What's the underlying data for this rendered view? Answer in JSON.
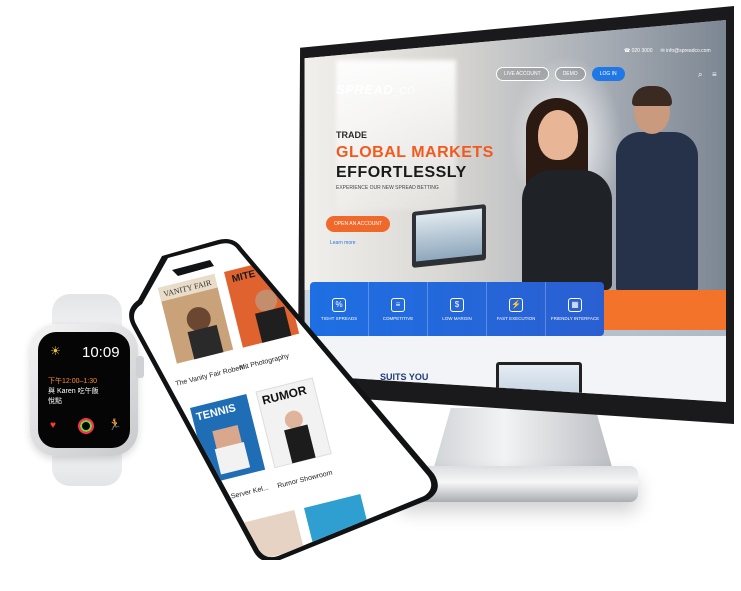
{
  "monitor": {
    "logo": "SPREAD",
    "logo_suffix": "CO",
    "top_contact": [
      "☎ 020 3000",
      "✉ info@spreadco.com"
    ],
    "nav": [
      "LIVE ACCOUNT",
      "DEMO",
      "LOG IN"
    ],
    "hero": {
      "kicker": "TRADE",
      "line1": "GLOBAL MARKETS",
      "line2": "EFFORTLESSLY",
      "tagline": "EXPERIENCE OUR NEW SPREAD BETTING",
      "cta": "OPEN AN ACCOUNT",
      "link": "Learn more"
    },
    "features": [
      {
        "icon": "%",
        "label": "TIGHT SPREADS"
      },
      {
        "icon": "≡",
        "label": "COMPETITIVE"
      },
      {
        "icon": "$",
        "label": "LOW MARGIN"
      },
      {
        "icon": "⚡",
        "label": "FAST EXECUTION"
      },
      {
        "icon": "▦",
        "label": "FRIENDLY INTERFACE"
      }
    ],
    "suits_text": "SUITS YOU"
  },
  "phone": {
    "items": [
      {
        "title": "The Vanity Fair Robert...",
        "cover_title": "VANITY FAIR",
        "color": "#c9a27a"
      },
      {
        "title": "Mit Photography",
        "cover_title": "MITE",
        "color": "#e0622e"
      },
      {
        "title": "Tennis Server Kel...",
        "cover_title": "TENNIS",
        "color": "#1f6db5"
      },
      {
        "title": "Rumor Showroom",
        "cover_title": "RUMOR",
        "color": "#f2f2f2"
      }
    ]
  },
  "watch": {
    "time": "10:09",
    "event_time": "下午12:00–1:30",
    "event_title": "與 Karen 吃午飯",
    "event_place": "悅點"
  }
}
